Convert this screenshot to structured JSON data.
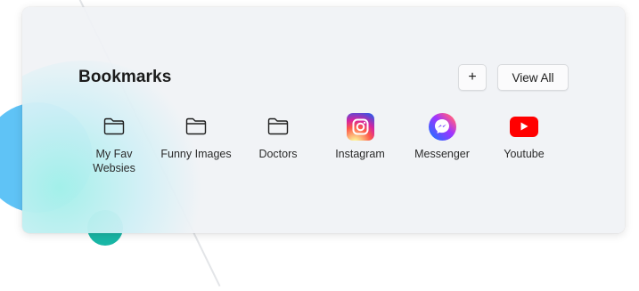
{
  "widget": {
    "title": "Bookmarks",
    "add_label": "+",
    "view_all_label": "View All"
  },
  "bookmarks": [
    {
      "label": "My Fav Websies",
      "icon": "folder-icon"
    },
    {
      "label": "Funny Images",
      "icon": "folder-icon"
    },
    {
      "label": "Doctors",
      "icon": "folder-icon"
    },
    {
      "label": "Instagram",
      "icon": "instagram-icon"
    },
    {
      "label": "Messenger",
      "icon": "messenger-icon"
    },
    {
      "label": "Youtube",
      "icon": "youtube-icon"
    }
  ],
  "colors": {
    "card_background": "#f0f2f5",
    "instagram_brand": "#d6249f",
    "messenger_brand": "#0a7cff",
    "youtube_brand": "#ff0000"
  }
}
